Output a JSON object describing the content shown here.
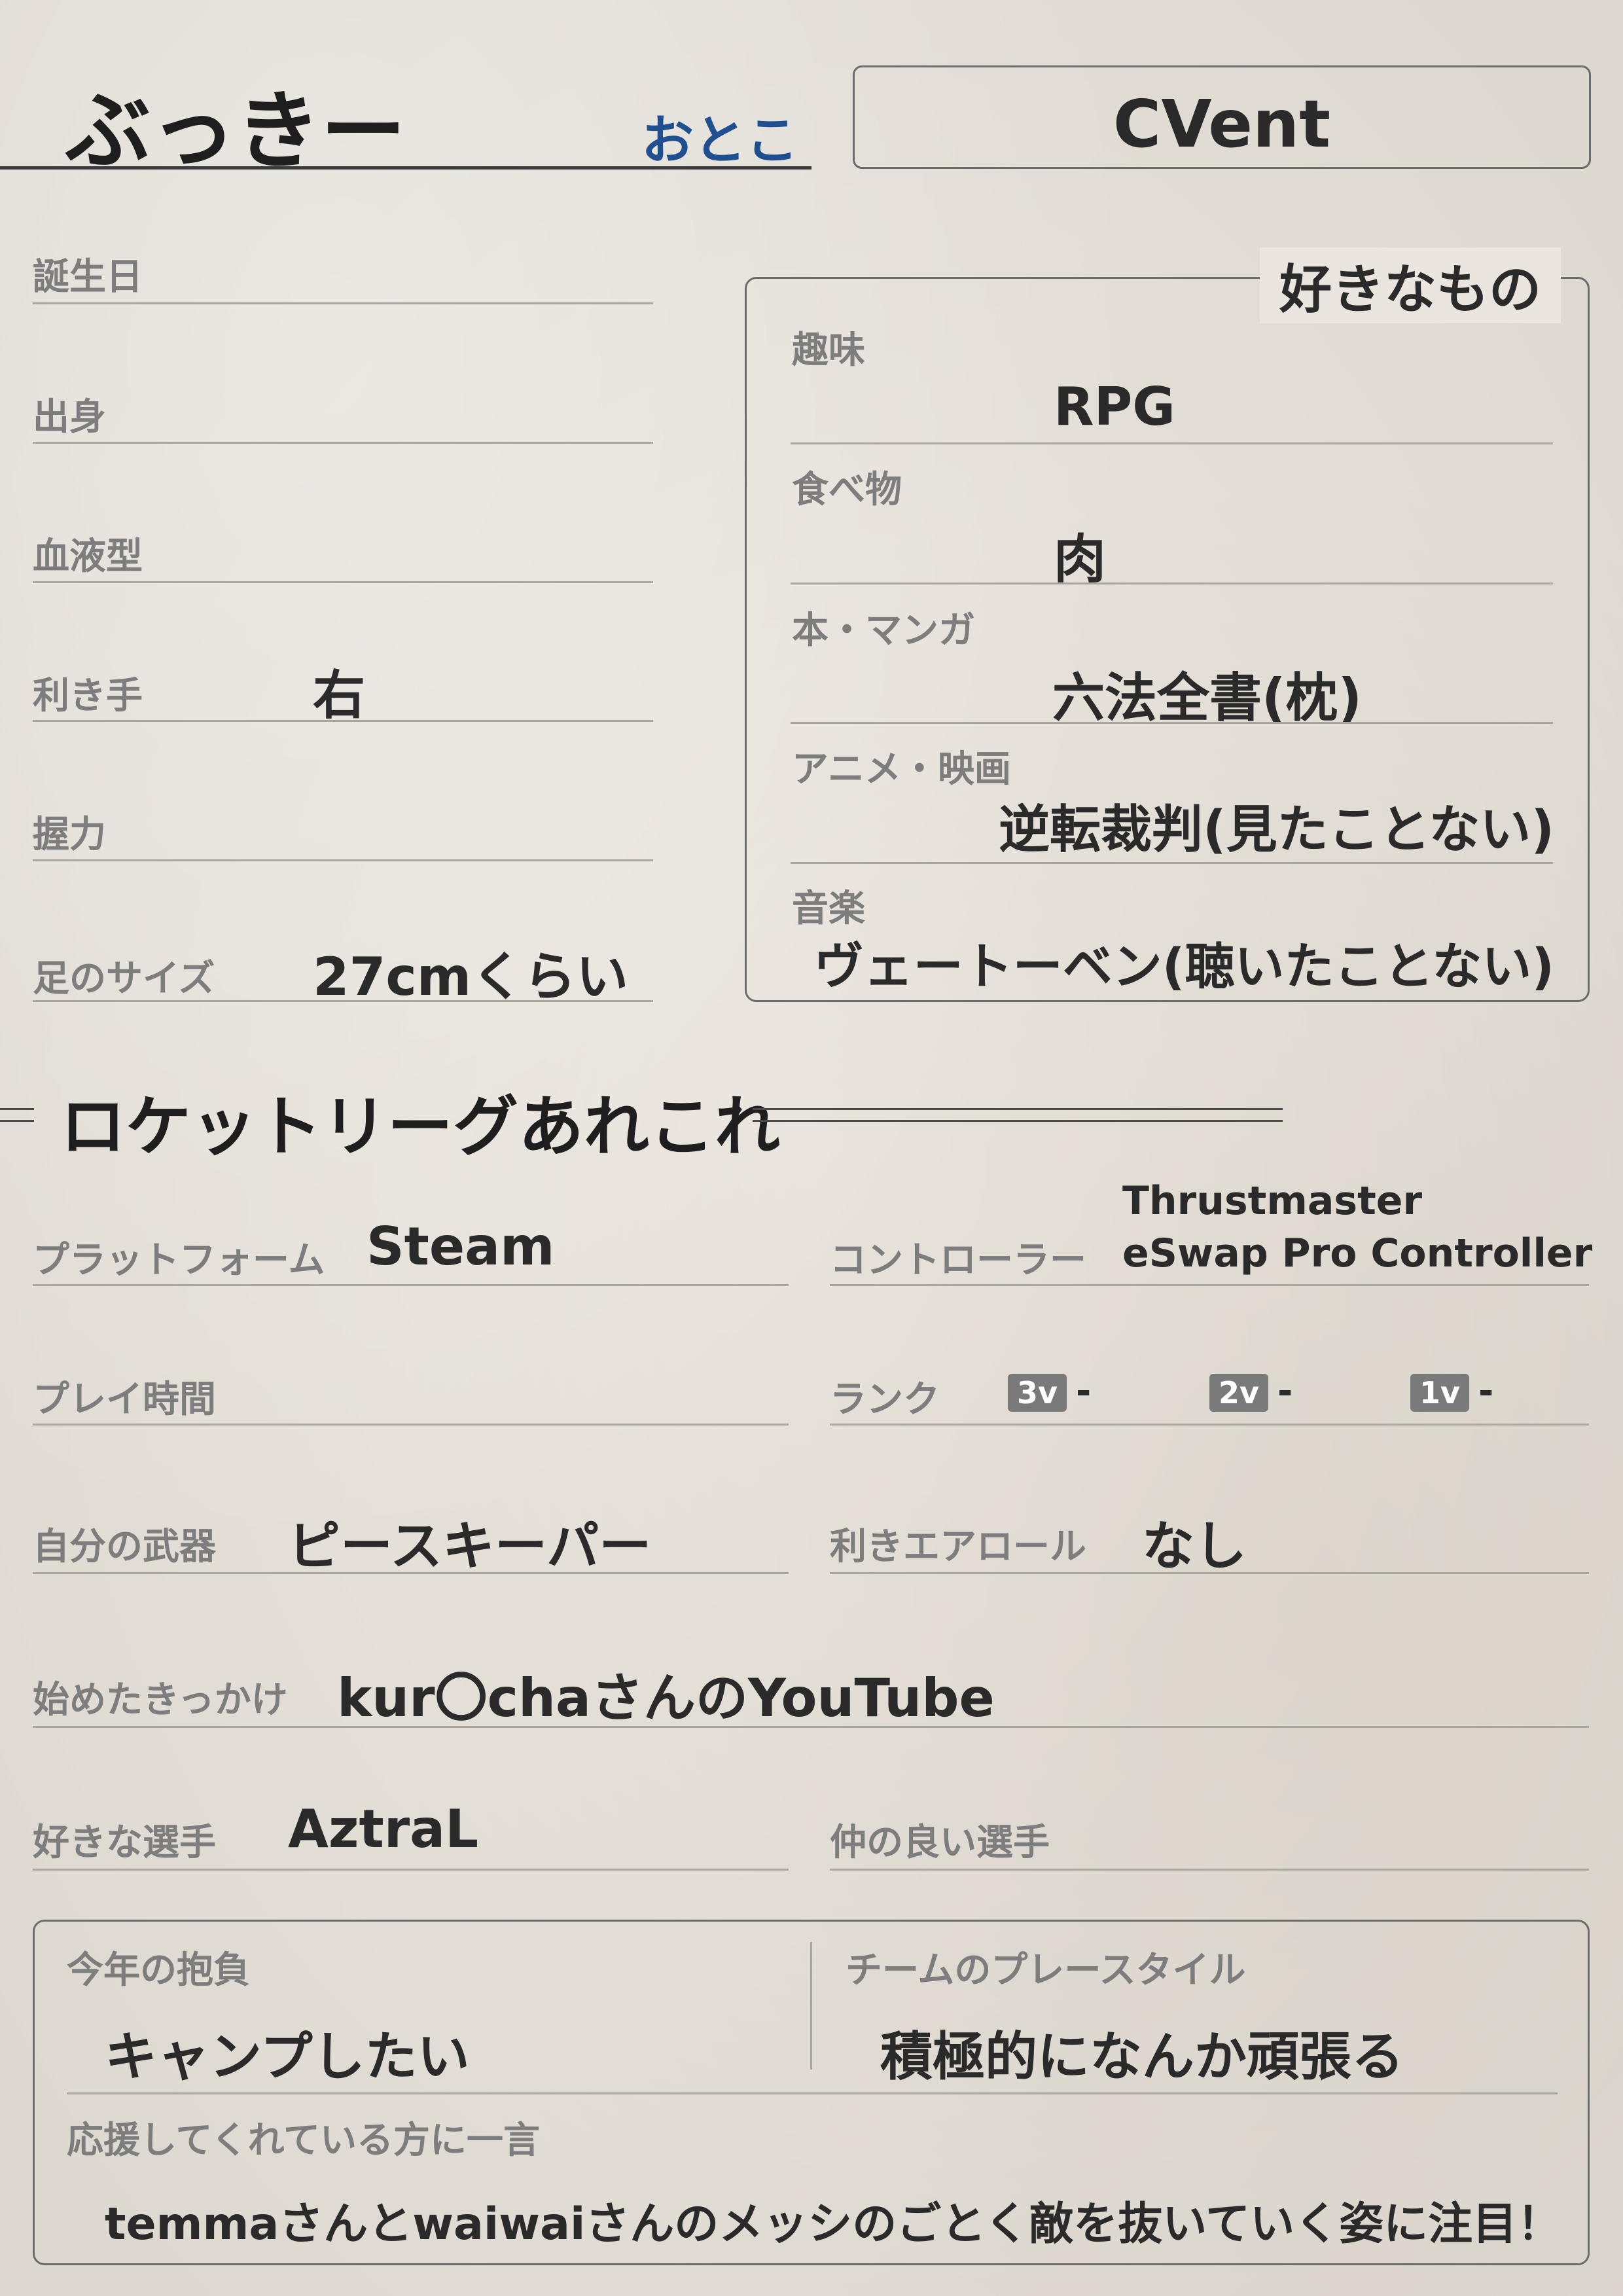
{
  "header": {
    "name": "ぶっきー",
    "gender": "おとこ",
    "team": "CVent",
    "gender_color": "#1f4f8f"
  },
  "profile": [
    {
      "label": "誕生日",
      "value": ""
    },
    {
      "label": "出身",
      "value": ""
    },
    {
      "label": "血液型",
      "value": ""
    },
    {
      "label": "利き手",
      "value": "右"
    },
    {
      "label": "握力",
      "value": ""
    },
    {
      "label": "足のサイズ",
      "value": "27cmくらい"
    }
  ],
  "favorites": {
    "title": "好きなもの",
    "items": [
      {
        "label": "趣味",
        "value": "RPG"
      },
      {
        "label": "食べ物",
        "value": "肉"
      },
      {
        "label": "本・マンガ",
        "value": "六法全書(枕)"
      },
      {
        "label": "アニメ・映画",
        "value": "逆転裁判(見たことない)"
      },
      {
        "label": "音楽",
        "value": "ヴェートーベン(聴いたことない)"
      }
    ]
  },
  "rocket_league": {
    "title": "ロケットリーグあれこれ",
    "platform": {
      "label": "プラットフォーム",
      "value": "Steam"
    },
    "controller": {
      "label": "コントローラー",
      "value_line1": "Thrustmaster",
      "value_line2": "eSwap Pro Controller"
    },
    "playtime": {
      "label": "プレイ時間",
      "value": ""
    },
    "rank": {
      "label": "ランク",
      "entries": [
        {
          "mode": "3v",
          "value": "-"
        },
        {
          "mode": "2v",
          "value": "-"
        },
        {
          "mode": "1v",
          "value": "-"
        }
      ]
    },
    "weapon": {
      "label": "自分の武器",
      "value": "ピースキーパー"
    },
    "role": {
      "label": "利きエアロール",
      "value": "なし"
    },
    "trigger": {
      "label": "始めたきっかけ",
      "value": "kur〇chaさんのYouTube"
    },
    "fav_player": {
      "label": "好きな選手",
      "value": "AztraL"
    },
    "friend_player": {
      "label": "仲の良い選手",
      "value": ""
    }
  },
  "bottom": {
    "goal": {
      "label": "今年の抱負",
      "value": "キャンプしたい"
    },
    "team_style": {
      "label": "チームのプレースタイル",
      "value": "積極的になんか頑張る"
    },
    "message": {
      "label": "応援してくれている方に一言",
      "value": "temmaさんとwaiwaiさんのメッシのごとく敵を抜いていく姿に注目！"
    }
  }
}
